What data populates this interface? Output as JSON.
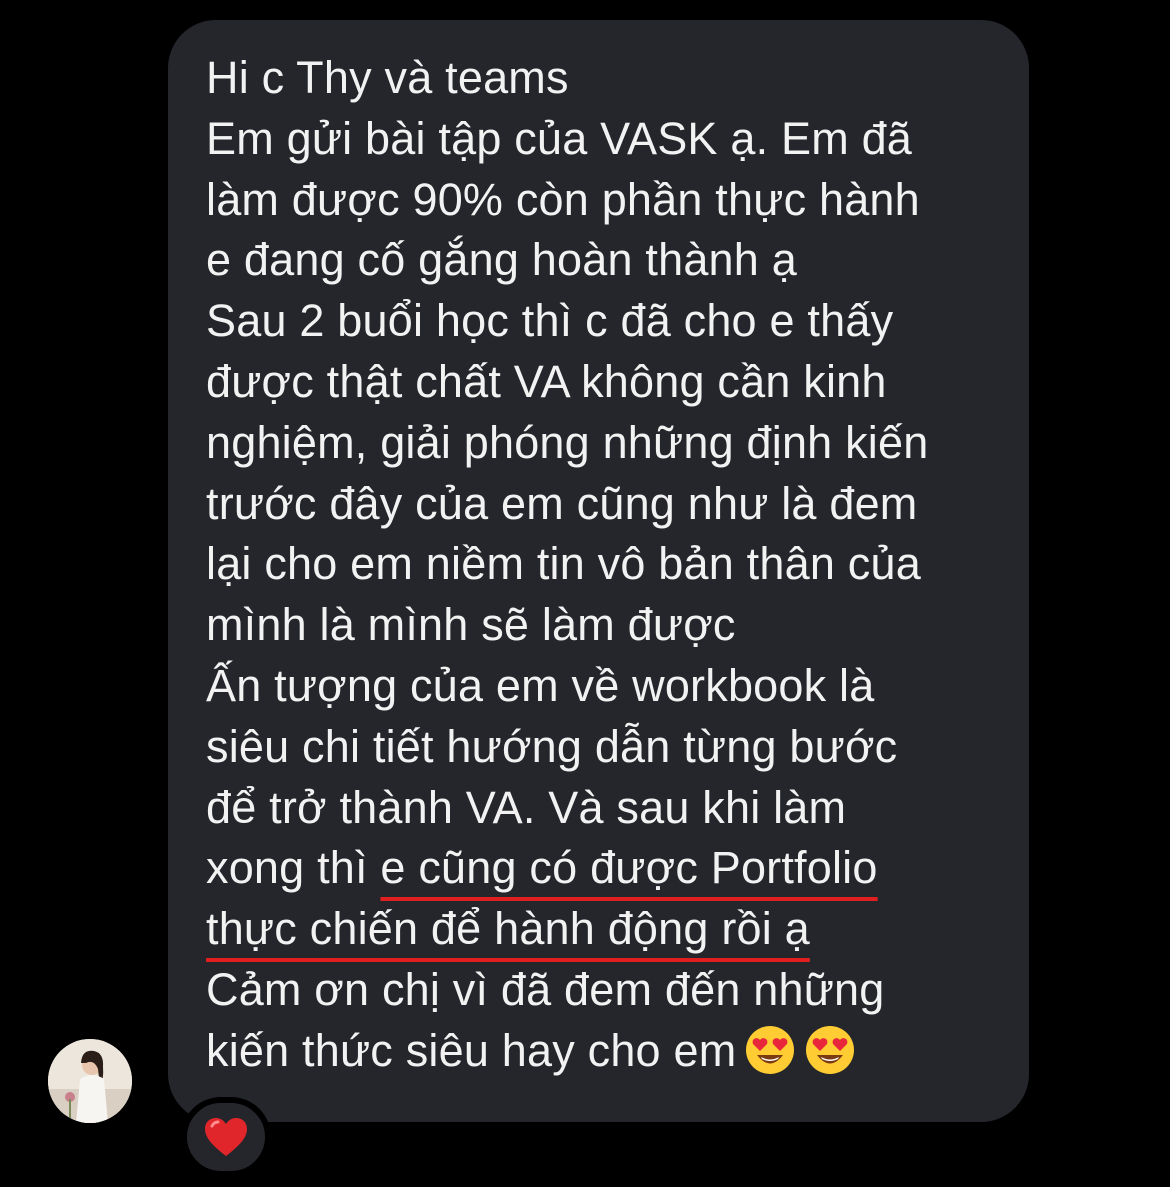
{
  "message": {
    "lines": [
      "Hi c Thy và teams",
      "Em gửi bài tập của VASK ạ. Em đã",
      "làm được 90% còn phần thực hành",
      "e đang cố gắng hoàn thành ạ",
      "Sau 2 buổi học thì c đã cho e thấy",
      "được thật chất VA không cần kinh",
      "nghiệm, giải phóng những định kiến",
      "trước đây của em cũng như là đem",
      "lại cho em niềm tin vô bản thân của",
      "mình là mình sẽ làm được",
      "Ấn tượng của em về workbook là",
      "siêu chi tiết hướng dẫn từng bước",
      "để trở thành VA. Và sau khi làm"
    ],
    "line14_plain": "xong thì ",
    "line14_underlined": "e cũng có được Portfolio",
    "line15_underlined": "thực chiến để hành động rồi ạ",
    "line16": "Cảm ơn chị vì đã đem đến những",
    "line17": "kiến thức siêu hay cho em",
    "underline_color": "#e02020",
    "bubble_color": "#24262b",
    "text_color": "#f2f2f2"
  },
  "trailing_emojis": [
    "heart-eyes-emoji",
    "heart-eyes-emoji"
  ],
  "reaction": {
    "icon": "red-heart-icon",
    "color": "#e0262b"
  },
  "sender": {
    "avatar_icon": "profile-photo"
  }
}
